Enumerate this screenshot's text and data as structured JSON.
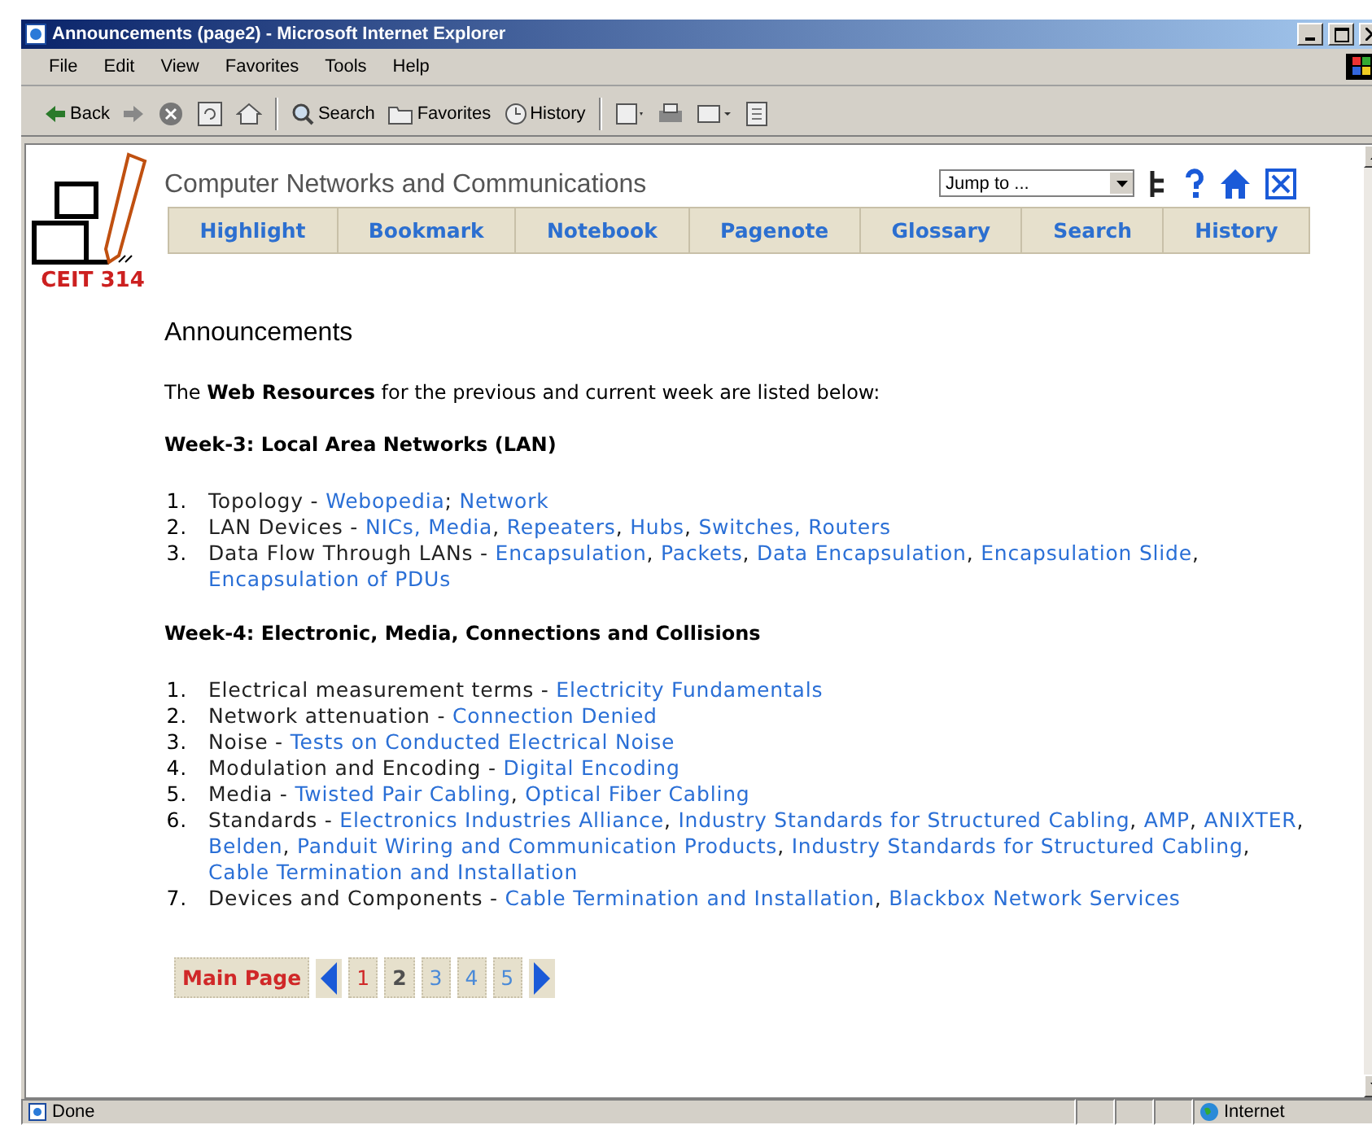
{
  "window": {
    "title": "Announcements (page2) - Microsoft Internet Explorer"
  },
  "menu": [
    "File",
    "Edit",
    "View",
    "Favorites",
    "Tools",
    "Help"
  ],
  "toolbar": [
    {
      "kind": "back",
      "label": "Back"
    },
    {
      "kind": "forward"
    },
    {
      "kind": "stop"
    },
    {
      "kind": "refresh"
    },
    {
      "kind": "home"
    },
    {
      "kind": "search",
      "label": "Search"
    },
    {
      "kind": "favorites",
      "label": "Favorites"
    },
    {
      "kind": "history",
      "label": "History"
    },
    {
      "kind": "mail"
    },
    {
      "kind": "print"
    },
    {
      "kind": "edit"
    },
    {
      "kind": "discuss"
    }
  ],
  "site": {
    "logo_text": "CEIT 314",
    "title": "Computer Networks and Communications",
    "jump": {
      "value": "Jump to ..."
    },
    "nav": [
      "Highlight",
      "Bookmark",
      "Notebook",
      "Pagenote",
      "Glossary",
      "Search",
      "History"
    ]
  },
  "page": {
    "heading": "Announcements",
    "intro": "The **Web Resources** for the previous and current week are listed below:",
    "weeks": [
      {
        "title": "Week-3: Local Area Networks (LAN)",
        "items": [
          {
            "number": "1.",
            "parts": [
              {
                "kind": "text",
                "text": "Topology - "
              },
              {
                "kind": "link",
                "text": "Webopedia"
              },
              {
                "kind": "text",
                "text": "; "
              },
              {
                "kind": "link",
                "text": "Network"
              }
            ]
          },
          {
            "number": "2.",
            "parts": [
              {
                "kind": "text",
                "text": "LAN Devices - "
              },
              {
                "kind": "link",
                "text": "NICs, Media"
              },
              {
                "kind": "text",
                "text": ", "
              },
              {
                "kind": "link",
                "text": "Repeaters"
              },
              {
                "kind": "text",
                "text": ", "
              },
              {
                "kind": "link",
                "text": "Hubs"
              },
              {
                "kind": "text",
                "text": ", "
              },
              {
                "kind": "link",
                "text": "Switches, Routers"
              }
            ]
          },
          {
            "number": "3.",
            "parts": [
              {
                "kind": "text",
                "text": "Data Flow Through LANs - "
              },
              {
                "kind": "link",
                "text": "Encapsulation"
              },
              {
                "kind": "text",
                "text": ", "
              },
              {
                "kind": "link",
                "text": "Packets"
              },
              {
                "kind": "text",
                "text": ", "
              },
              {
                "kind": "link",
                "text": "Data Encapsulation"
              },
              {
                "kind": "text",
                "text": ", "
              },
              {
                "kind": "link",
                "text": "Encapsulation Slide"
              },
              {
                "kind": "text",
                "text": ", "
              },
              {
                "kind": "link",
                "text": "Encapsulation of PDUs"
              }
            ]
          }
        ]
      },
      {
        "title": "Week-4: Electronic, Media, Connections and Collisions",
        "items": [
          {
            "number": "1.",
            "parts": [
              {
                "kind": "text",
                "text": "Electrical measurement terms - "
              },
              {
                "kind": "link",
                "text": "Electricity Fundamentals"
              }
            ]
          },
          {
            "number": "2.",
            "parts": [
              {
                "kind": "text",
                "text": "Network attenuation - "
              },
              {
                "kind": "link",
                "text": "Connection Denied"
              }
            ]
          },
          {
            "number": "3.",
            "parts": [
              {
                "kind": "text",
                "text": "Noise - "
              },
              {
                "kind": "link",
                "text": "Tests on Conducted Electrical Noise"
              }
            ]
          },
          {
            "number": "4.",
            "parts": [
              {
                "kind": "text",
                "text": "Modulation and Encoding - "
              },
              {
                "kind": "link",
                "text": "Digital Encoding"
              }
            ]
          },
          {
            "number": "5.",
            "parts": [
              {
                "kind": "text",
                "text": "Media - "
              },
              {
                "kind": "link",
                "text": "Twisted Pair Cabling"
              },
              {
                "kind": "text",
                "text": ", "
              },
              {
                "kind": "link",
                "text": "Optical Fiber Cabling"
              }
            ]
          },
          {
            "number": "6.",
            "parts": [
              {
                "kind": "text",
                "text": "Standards - "
              },
              {
                "kind": "link",
                "text": "Electronics Industries Alliance"
              },
              {
                "kind": "text",
                "text": ", "
              },
              {
                "kind": "link",
                "text": "Industry Standards for Structured Cabling"
              },
              {
                "kind": "text",
                "text": ", "
              },
              {
                "kind": "link",
                "text": "AMP"
              },
              {
                "kind": "text",
                "text": ", "
              },
              {
                "kind": "link",
                "text": "ANIXTER"
              },
              {
                "kind": "text",
                "text": ", "
              },
              {
                "kind": "link",
                "text": "Belden"
              },
              {
                "kind": "text",
                "text": ", "
              },
              {
                "kind": "link",
                "text": "Panduit Wiring and Communication Products"
              },
              {
                "kind": "text",
                "text": ", "
              },
              {
                "kind": "link",
                "text": "Industry Standards for Structured Cabling"
              },
              {
                "kind": "text",
                "text": ", "
              },
              {
                "kind": "link",
                "text": "Cable Termination and Installation"
              }
            ]
          },
          {
            "number": "7.",
            "parts": [
              {
                "kind": "text",
                "text": "Devices and Components - "
              },
              {
                "kind": "link",
                "text": "Cable Termination and Installation"
              },
              {
                "kind": "text",
                "text": ", "
              },
              {
                "kind": "link",
                "text": "Blackbox Network Services"
              }
            ]
          }
        ]
      }
    ],
    "pager": {
      "main": "Main Page",
      "pages": [
        {
          "label": "1",
          "kind": "visited",
          "selected": false
        },
        {
          "label": "2",
          "kind": "current",
          "selected": true
        },
        {
          "label": "3",
          "kind": "link",
          "selected": false
        },
        {
          "label": "4",
          "kind": "link",
          "selected": false
        },
        {
          "label": "5",
          "kind": "link",
          "selected": false
        }
      ]
    }
  },
  "status_bar": {
    "status": "Done",
    "zone": "Internet"
  }
}
